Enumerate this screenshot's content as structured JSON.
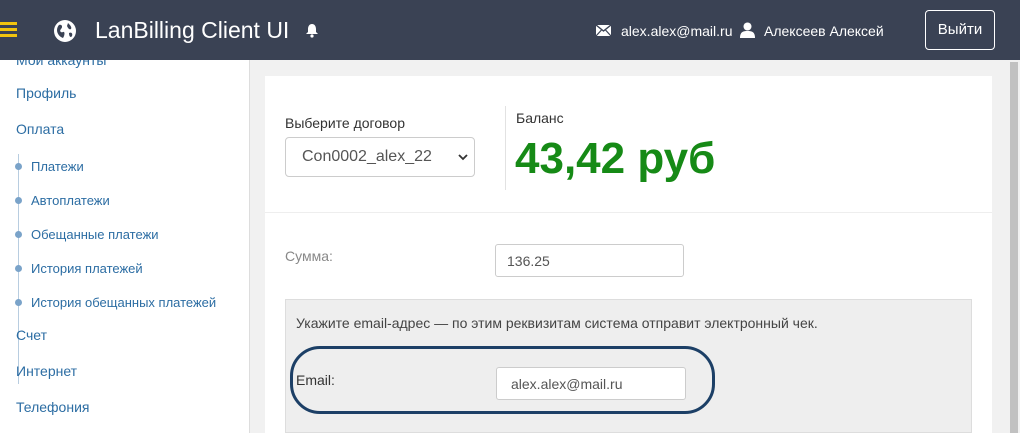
{
  "header": {
    "title": "LanBilling Client UI",
    "user_email": "alex.alex@mail.ru",
    "user_name": "Алексеев Алексей",
    "logout_label": "Выйти",
    "icons": [
      "menu-icon",
      "globe-icon",
      "bell-icon",
      "mail-icon",
      "user-icon"
    ]
  },
  "sidebar": {
    "items": [
      {
        "label": "Мои аккаунты"
      },
      {
        "label": "Профиль"
      },
      {
        "label": "Оплата"
      },
      {
        "label": "Платежи"
      },
      {
        "label": "Автоплатежи"
      },
      {
        "label": "Обещанные платежи"
      },
      {
        "label": "История платежей"
      },
      {
        "label": "История обещанных платежей"
      },
      {
        "label": "Счет"
      },
      {
        "label": "Интернет"
      },
      {
        "label": "Телефония"
      }
    ]
  },
  "main": {
    "contract_label": "Выберите договор",
    "contract_selected": "Con0002_alex_22",
    "balance_label": "Баланс",
    "balance_value": "43,42 руб",
    "sum_label": "Сумма:",
    "sum_value": "136.25",
    "receipt_hint": "Укажите email-адрес — по этим реквизитам система отправит электронный чек.",
    "email_label": "Email:",
    "email_value": "alex.alex@mail.ru"
  },
  "colors": {
    "header_bg": "#3a4254",
    "menu_accent": "#f1c40f",
    "link": "#2c6da3",
    "balance": "#168a16",
    "highlight_ring": "#1c3f66"
  }
}
